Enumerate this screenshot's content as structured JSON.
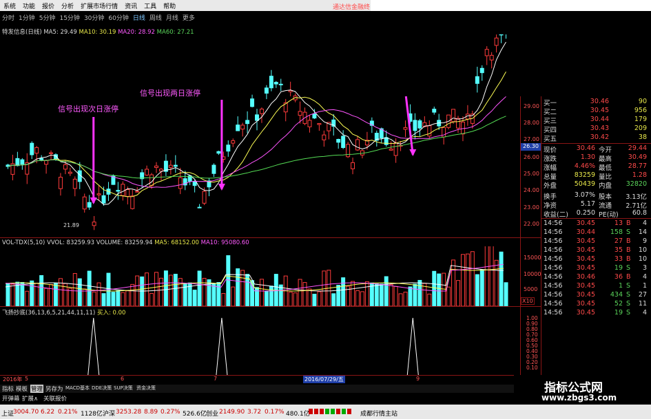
{
  "menu": [
    "系统",
    "功能",
    "报价",
    "分析",
    "扩展市场行情",
    "资讯",
    "工具",
    "帮助"
  ],
  "brand_text": "通达信金融终",
  "periods": [
    "分时",
    "1分钟",
    "5分钟",
    "15分钟",
    "30分钟",
    "60分钟",
    "日线",
    "周线",
    "月线",
    "更多"
  ],
  "selected_period": "日线",
  "main_title": {
    "name": "特发信息(日线)",
    "ma5": "MA5: 29.49",
    "ma10": "MA10: 30.19",
    "ma20": "MA20: 28.92",
    "ma60": "MA60: 27.21"
  },
  "annotations": {
    "signal1": "信号出现次日涨停",
    "signal2": "信号出现两日涨停",
    "low_price": "21.89"
  },
  "price_axis": [
    "29.00",
    "28.00",
    "27.00",
    "26.00",
    "25.00",
    "24.00",
    "23.00",
    "22.00"
  ],
  "price_marker": "26.30",
  "vol_title": {
    "name": "VOL-TDX(5,10)",
    "vvol": "VVOL: 83259.93",
    "volume": "VOLUME: 83259.94",
    "ma5": "MA5: 68152.00",
    "ma10": "MA10: 95080.60"
  },
  "vol_axis": [
    "15000",
    "10000",
    "5000"
  ],
  "vol_unit": "X10",
  "ind_title": {
    "name": "飞扬抄底(36,13,6,5,21,44,11,11)",
    "buy": "买入: 0.00"
  },
  "ind_axis": [
    "1.00",
    "0.90",
    "0.80",
    "0.70",
    "0.60",
    "0.50",
    "0.40",
    "0.30",
    "0.20",
    "0.10"
  ],
  "chart_data": {
    "type": "candlestick",
    "note": "K-line daily price chart with volume and indicator subcharts",
    "ylim": [
      21.5,
      29.5
    ],
    "signal_days": [
      0.175,
      0.43,
      0.81
    ]
  },
  "quotes": {
    "asks": [
      [
        "买一",
        "30.46",
        "90"
      ],
      [
        "买二",
        "30.45",
        "956"
      ],
      [
        "买三",
        "30.44",
        "179"
      ],
      [
        "买四",
        "30.43",
        "209"
      ],
      [
        "买五",
        "30.42",
        "38"
      ]
    ],
    "stats": [
      [
        "现价",
        "30.46",
        "今开",
        "29.44"
      ],
      [
        "涨跌",
        "1.30",
        "最高",
        "30.49"
      ],
      [
        "涨幅",
        "4.46%",
        "最低",
        "28.77"
      ],
      [
        "总量",
        "83259",
        "量比",
        "1.28"
      ],
      [
        "外盘",
        "50439",
        "内盘",
        "32820"
      ],
      [
        "换手",
        "3.07%",
        "股本",
        "3.13亿"
      ],
      [
        "净资",
        "5.17",
        "流通",
        "2.71亿"
      ],
      [
        "收益(二)",
        "0.250",
        "PE(动)",
        "60.8"
      ]
    ],
    "ticks": [
      [
        "14:56",
        "30.45",
        "13",
        "B",
        "4"
      ],
      [
        "14:56",
        "30.44",
        "158",
        "S",
        "14"
      ],
      [
        "14:56",
        "30.45",
        "27",
        "B",
        "9"
      ],
      [
        "14:56",
        "30.45",
        "35",
        "B",
        "10"
      ],
      [
        "14:56",
        "30.45",
        "33",
        "B",
        "10"
      ],
      [
        "14:56",
        "30.45",
        "19",
        "S",
        "3"
      ],
      [
        "14:56",
        "30.46",
        "36",
        "B",
        "4"
      ],
      [
        "14:56",
        "30.45",
        "1",
        "S",
        "1"
      ],
      [
        "14:56",
        "30.45",
        "434",
        "S",
        "27"
      ],
      [
        "14:56",
        "30.45",
        "52",
        "S",
        "11"
      ],
      [
        "14:56",
        "30.45",
        "19",
        "S",
        "4"
      ]
    ]
  },
  "date_axis": {
    "year": "2016年",
    "m5": "5",
    "m6": "6",
    "m7": "7",
    "current": "2016/07/29/五",
    "m9": "9"
  },
  "bottom_tabs": [
    "指标",
    "模板",
    "管理",
    "另存为",
    "MACD基本",
    "DDE决策",
    "SUP决策",
    "资金决策"
  ],
  "bottom_tabs2": [
    "开弹幕",
    "扩展∧",
    "关联报价"
  ],
  "status": [
    {
      "name": "上证",
      "val": "3004.70",
      "chg": "6.22",
      "pct": "0.21%",
      "amt": "1128亿"
    },
    {
      "name": "沪深",
      "val": "3253.28",
      "chg": "8.89",
      "pct": "0.27%",
      "amt": "526.6亿"
    },
    {
      "name": "创业",
      "val": "2149.90",
      "chg": "3.72",
      "pct": "0.17%",
      "amt": "480.1亿"
    }
  ],
  "status_right": "成都行情主站",
  "watermark": {
    "cn": "指标公式网",
    "url": "www.zbgs3.com"
  },
  "colors": {
    "up": "#ff3b3b",
    "down": "#55ffff",
    "ma5": "#ffffff",
    "ma10": "#ffff55",
    "ma20": "#ff55ff",
    "ma60": "#55dd55",
    "arrow": "#ff33ff",
    "grid": "#8b1515"
  }
}
